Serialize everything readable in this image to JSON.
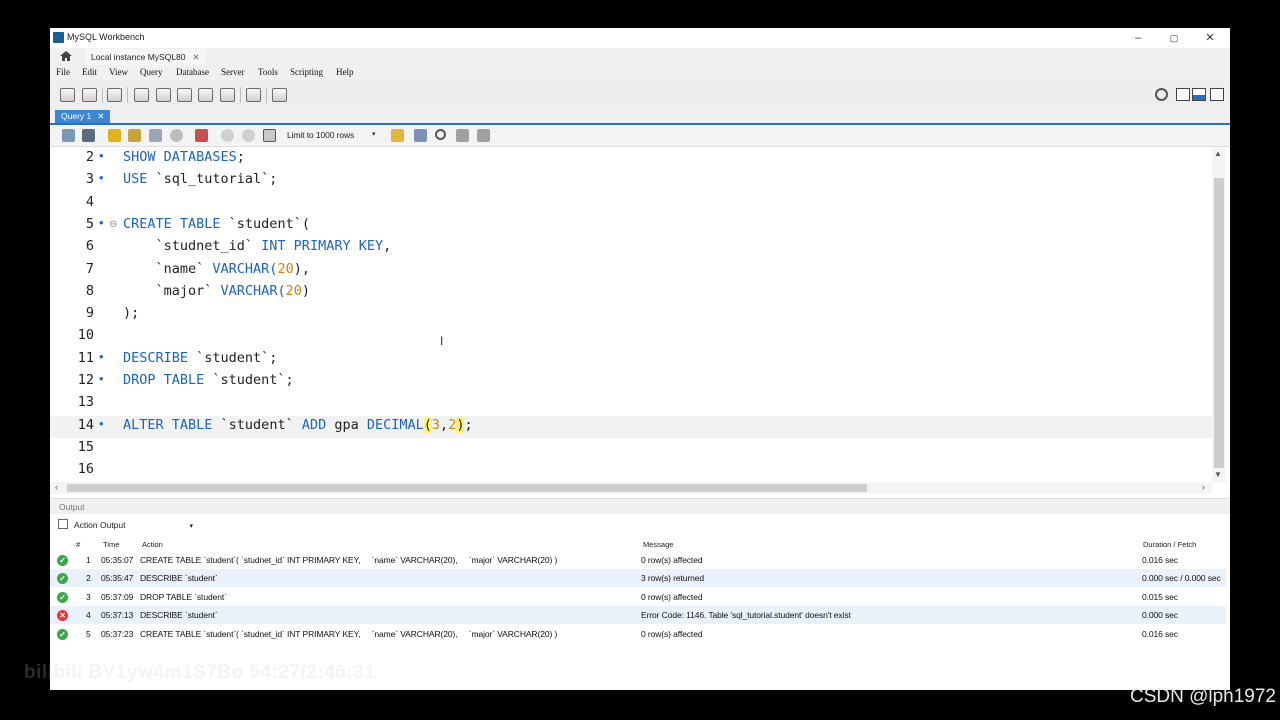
{
  "window": {
    "title": "MySQL Workbench",
    "minimize": "–",
    "maximize": "▢",
    "close": "✕"
  },
  "connection_tab": {
    "label": "Local instance MySQL80",
    "close": "✕"
  },
  "menu": [
    "File",
    "Edit",
    "View",
    "Query",
    "Database",
    "Server",
    "Tools",
    "Scripting",
    "Help"
  ],
  "query_tab": {
    "label": "Query 1",
    "close": "✕"
  },
  "sql_toolbar": {
    "limit_label": "Limit to 1000 rows",
    "limit_arrow": "▾"
  },
  "editor": {
    "lines": [
      {
        "num": "2",
        "marker": "•",
        "tokens": [
          {
            "t": "SHOW DATABASES",
            "c": "kw"
          },
          {
            "t": ";",
            "c": ""
          }
        ]
      },
      {
        "num": "3",
        "marker": "•",
        "tokens": [
          {
            "t": "USE ",
            "c": "kw"
          },
          {
            "t": "`sql_tutorial`;",
            "c": ""
          }
        ]
      },
      {
        "num": "4",
        "marker": "",
        "tokens": []
      },
      {
        "num": "5",
        "marker": "•",
        "fold": "⊖",
        "tokens": [
          {
            "t": "CREATE TABLE ",
            "c": "kw"
          },
          {
            "t": "`student`(",
            "c": ""
          }
        ]
      },
      {
        "num": "6",
        "marker": "",
        "tokens": [
          {
            "t": "    `studnet_id` ",
            "c": ""
          },
          {
            "t": "INT PRIMARY KEY",
            "c": "kw"
          },
          {
            "t": ",",
            "c": ""
          }
        ]
      },
      {
        "num": "7",
        "marker": "",
        "tokens": [
          {
            "t": "    `name` ",
            "c": ""
          },
          {
            "t": "VARCHAR(",
            "c": "kw"
          },
          {
            "t": "20",
            "c": "num"
          },
          {
            "t": "),",
            "c": ""
          }
        ]
      },
      {
        "num": "8",
        "marker": "",
        "tokens": [
          {
            "t": "    `major` ",
            "c": ""
          },
          {
            "t": "VARCHAR(",
            "c": "kw"
          },
          {
            "t": "20",
            "c": "num"
          },
          {
            "t": ")",
            "c": ""
          }
        ]
      },
      {
        "num": "9",
        "marker": "",
        "tokens": [
          {
            "t": ");",
            "c": ""
          }
        ]
      },
      {
        "num": "10",
        "marker": "",
        "tokens": []
      },
      {
        "num": "11",
        "marker": "•",
        "tokens": [
          {
            "t": "DESCRIBE ",
            "c": "kw"
          },
          {
            "t": "`student`;",
            "c": ""
          }
        ]
      },
      {
        "num": "12",
        "marker": "•",
        "tokens": [
          {
            "t": "DROP TABLE ",
            "c": "kw"
          },
          {
            "t": "`student`;",
            "c": ""
          }
        ]
      },
      {
        "num": "13",
        "marker": "",
        "tokens": []
      },
      {
        "num": "14",
        "marker": "•",
        "current": true,
        "tokens": [
          {
            "t": "ALTER TABLE ",
            "c": "kw"
          },
          {
            "t": "`student` ",
            "c": ""
          },
          {
            "t": "ADD ",
            "c": "kw"
          },
          {
            "t": "gpa ",
            "c": ""
          },
          {
            "t": "DECIMAL",
            "c": "kw"
          },
          {
            "t": "(",
            "c": "hl"
          },
          {
            "t": "3",
            "c": "num"
          },
          {
            "t": ",",
            "c": ""
          },
          {
            "t": "2",
            "c": "num"
          },
          {
            "t": ")",
            "c": "hl"
          },
          {
            "t": ";",
            "c": ""
          }
        ]
      },
      {
        "num": "15",
        "marker": "",
        "tokens": []
      },
      {
        "num": "16",
        "marker": "",
        "tokens": []
      }
    ]
  },
  "output": {
    "header": "Output",
    "selector": "Action Output",
    "columns": {
      "index": "#",
      "time": "Time",
      "action": "Action",
      "message": "Message",
      "duration": "Duration / Fetch"
    },
    "rows": [
      {
        "status": "ok",
        "index": "1",
        "time": "05:35:07",
        "action": "CREATE TABLE `student`( `studnet_id` INT PRIMARY KEY,     `name` VARCHAR(20),     `major` VARCHAR(20) )",
        "message": "0 row(s) affected",
        "duration": "0.016 sec"
      },
      {
        "status": "ok",
        "index": "2",
        "time": "05:35:47",
        "action": "DESCRIBE `student`",
        "message": "3 row(s) returned",
        "duration": "0.000 sec / 0.000 sec"
      },
      {
        "status": "ok",
        "index": "3",
        "time": "05:37:09",
        "action": "DROP TABLE `student`",
        "message": "0 row(s) affected",
        "duration": "0.015 sec"
      },
      {
        "status": "err",
        "index": "4",
        "time": "05:37:13",
        "action": "DESCRIBE `student`",
        "message": "Error Code: 1146. Table 'sql_tutorial.student' doesn't exist",
        "duration": "0.000 sec"
      },
      {
        "status": "ok",
        "index": "5",
        "time": "05:37:23",
        "action": "CREATE TABLE `student`( `studnet_id` INT PRIMARY KEY,     `name` VARCHAR(20),     `major` VARCHAR(20) )",
        "message": "0 row(s) affected",
        "duration": "0.016 sec"
      }
    ]
  },
  "overlay": {
    "watermark": "bilibili BV1yw4m1S7Bo 54:27/2:46:31",
    "credit": "CSDN @lph1972"
  }
}
